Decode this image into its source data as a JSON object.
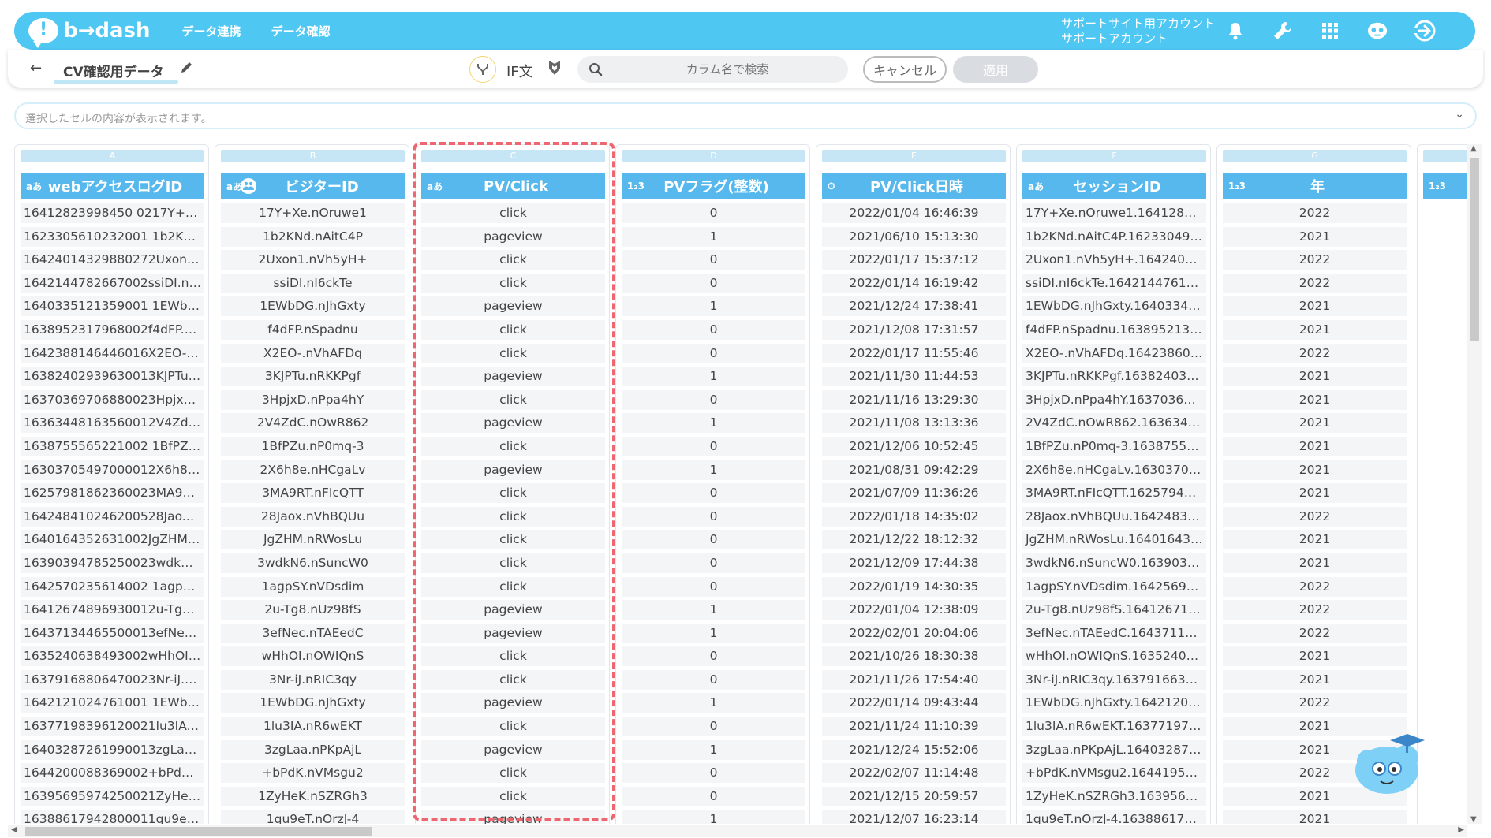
{
  "header": {
    "logo_text": "b→dash",
    "nav": [
      "データ連携",
      "データ確認"
    ],
    "account_line1": "サポートサイト用アカウント",
    "account_line2": "サポートアカウント",
    "accent_color": "#4ec7f3"
  },
  "toolbar": {
    "back_icon": "←",
    "dataset_name": "CV確認用データ",
    "if_label": "IF文",
    "search_placeholder": "カラム名で検索",
    "cancel_label": "キャンセル",
    "apply_label": "適用"
  },
  "cell_bar": {
    "placeholder": "選択したセルの内容が表示されます。",
    "chevron": "⌄"
  },
  "columns": [
    {
      "letter": "A",
      "type": "aあ",
      "name": "webアクセスログID",
      "cells": [
        "16412823998450 0217Y+Xe....",
        "1623305610232001 1b2KNd....",
        "16424014329880272Uxon1....",
        "1642144782667002ssiDI.nI....",
        "1640335121359001 1EWbD....",
        "1638952317968002f4dFP.n....",
        "1642388146446016X2EO-.n....",
        "16382402939630013KJPTu....",
        "16370369706880023HpjxD....",
        "16363448163560012V4ZdC....",
        "1638755565221002 1BfPZu....",
        "16303705497000012X6h8e....",
        "16257981862360023MA9RT....",
        "164248410246200528Jaox....",
        "1640164352631002JgZHM....",
        "16390394785250023wdkN6....",
        "1642570235614002 1agpSY....",
        "16412674896930012u-Tg8....",
        "16437134465500013efNec....",
        "1635240638493002wHhOI.n....",
        "16379168806470023Nr-iJ.n....",
        "1642121024761001 1EWbD....",
        "16377198396120021lu3IA....",
        "16403287261990013zgLaa....",
        "1644200088369002+bPdK.n....",
        "16395695974250021ZyHeK....",
        "16388617942800011qu9eT...."
      ]
    },
    {
      "letter": "B",
      "type": "aあ",
      "name": "ビジターID",
      "cells": [
        "17Y+Xe.nOruwe1",
        "1b2KNd.nAitC4P",
        "2Uxon1.nVh5yH+",
        "ssiDI.nI6ckTe",
        "1EWbDG.nJhGxty",
        "f4dFP.nSpadnu",
        "X2EO-.nVhAFDq",
        "3KJPTu.nRKKPgf",
        "3HpjxD.nPpa4hY",
        "2V4ZdC.nOwR862",
        "1BfPZu.nP0mq-3",
        "2X6h8e.nHCgaLv",
        "3MA9RT.nFIcQTT",
        "28Jaox.nVhBQUu",
        "JgZHM.nRWosLu",
        "3wdkN6.nSuncW0",
        "1agpSY.nVDsdim",
        "2u-Tg8.nUz98fS",
        "3efNec.nTAEedC",
        "wHhOI.nOWIQnS",
        "3Nr-iJ.nRIC3qy",
        "1EWbDG.nJhGxty",
        "1lu3IA.nR6wEKT",
        "3zgLaa.nPKpAjL",
        "+bPdK.nVMsgu2",
        "1ZyHeK.nSZRGh3",
        "1qu9eT.nOrzJ-4"
      ]
    },
    {
      "letter": "C",
      "type": "aあ",
      "name": "PV/Click",
      "cells": [
        "click",
        "pageview",
        "click",
        "click",
        "pageview",
        "click",
        "click",
        "pageview",
        "click",
        "pageview",
        "click",
        "pageview",
        "click",
        "click",
        "click",
        "click",
        "click",
        "pageview",
        "pageview",
        "click",
        "click",
        "pageview",
        "click",
        "pageview",
        "click",
        "click",
        "pageview"
      ]
    },
    {
      "letter": "D",
      "type": "1₂3",
      "name": "PVフラグ(整数)",
      "cells": [
        "0",
        "1",
        "0",
        "0",
        "1",
        "0",
        "0",
        "1",
        "0",
        "1",
        "0",
        "1",
        "0",
        "0",
        "0",
        "0",
        "0",
        "1",
        "1",
        "0",
        "0",
        "1",
        "0",
        "1",
        "0",
        "0",
        "1"
      ]
    },
    {
      "letter": "E",
      "type": "⏱",
      "name": "PV/Click日時",
      "cells": [
        "2022/01/04 16:46:39",
        "2021/06/10 15:13:30",
        "2022/01/17 15:37:12",
        "2022/01/14 16:19:42",
        "2021/12/24 17:38:41",
        "2021/12/08 17:31:57",
        "2022/01/17 11:55:46",
        "2021/11/30 11:44:53",
        "2021/11/16 13:29:30",
        "2021/11/08 13:13:36",
        "2021/12/06 10:52:45",
        "2021/08/31 09:42:29",
        "2021/07/09 11:36:26",
        "2022/01/18 14:35:02",
        "2021/12/22 18:12:32",
        "2021/12/09 17:44:38",
        "2022/01/19 14:30:35",
        "2022/01/04 12:38:09",
        "2022/02/01 20:04:06",
        "2021/10/26 18:30:38",
        "2021/11/26 17:54:40",
        "2022/01/14 09:43:44",
        "2021/11/24 11:10:39",
        "2021/12/24 15:52:06",
        "2022/02/07 11:14:48",
        "2021/12/15 20:59:57",
        "2021/12/07 16:23:14"
      ]
    },
    {
      "letter": "F",
      "type": "aあ",
      "name": "セッションID",
      "cells": [
        "17Y+Xe.nOruwe1.16412805....",
        "1b2KNd.nAitC4P.162330495....",
        "2Uxon1.nVh5yH+.16424011....",
        "ssiDI.nI6ckTe.164214476147....",
        "1EWbDG.nJhGxty.16403342....",
        "f4dFP.nSpadnu.1638952130....",
        "X2EO-.nVhAFDq.164238601....",
        "3KJPTu.nRKKPgf.163824030....",
        "3HpjxD.nPpa4hY.163703696....",
        "2V4ZdC.nOwR862.16363448....",
        "1BfPZu.nP0mq-3.16387554....",
        "2X6h8e.nHCgaLv.163037040....",
        "3MA9RT.nFIcQTT.162579499....",
        "28Jaox.nVhBQUu.164248312....",
        "JgZHM.nRWosLu.164016432....",
        "3wdkN6.nSuncW0.16390394....",
        "1agpSY.nVDsdim.164256976....",
        "2u-Tg8.nUz98fS.164126710....",
        "3efNec.nTAEedC.164371171....",
        "wHhOI.nOWIQnS.163524027....",
        "3Nr-iJ.nRIC3qy.1637916638....",
        "1EWbDG.nJhGxty.16421208....",
        "1lu3IA.nR6wEKT.163771979....",
        "3zgLaa.nPKpAjL.164032871....",
        "+bPdK.nVMsgu2.164419548....",
        "1ZyHeK.nSZRGh3.16395694....",
        "1qu9eT.nOrzJ-4.163886179...."
      ]
    },
    {
      "letter": "G",
      "type": "1₂3",
      "name": "年",
      "cells": [
        "2022",
        "2021",
        "2022",
        "2022",
        "2021",
        "2021",
        "2022",
        "2021",
        "2021",
        "2021",
        "2021",
        "2021",
        "2021",
        "2022",
        "2021",
        "2021",
        "2022",
        "2022",
        "2022",
        "2021",
        "2021",
        "2022",
        "2021",
        "2021",
        "2022",
        "2021",
        "2021"
      ]
    },
    {
      "letter": "",
      "type": "1₂3",
      "name": "",
      "cells": []
    }
  ]
}
